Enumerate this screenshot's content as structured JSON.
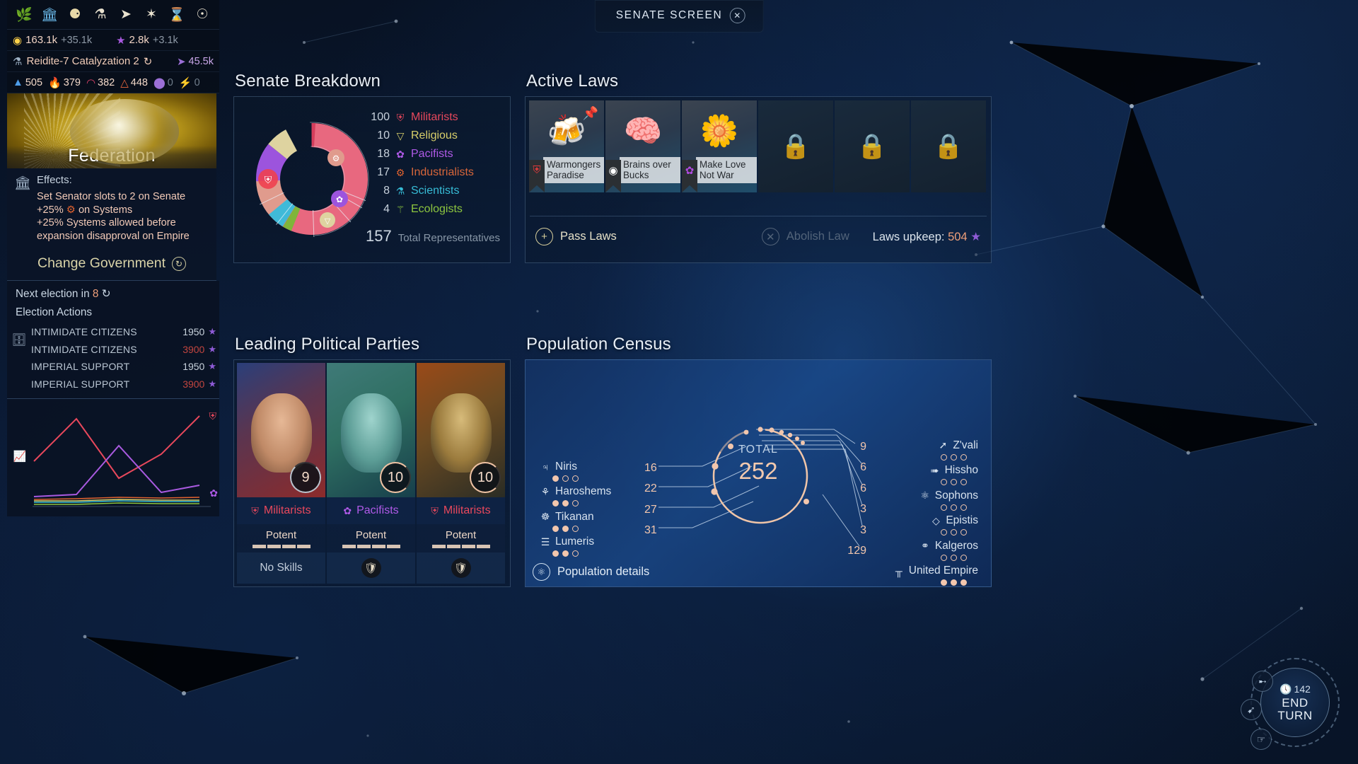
{
  "screen": {
    "title": "SENATE SCREEN",
    "close_icon": "close-icon"
  },
  "hud": {
    "icons": [
      "laurel-icon",
      "senate-building-icon",
      "coins-icon",
      "science-flask-icon",
      "ship-icon",
      "quest-sun-icon",
      "hourglass-icon",
      "eye-icon"
    ],
    "resources": {
      "dust_value": "163.1k",
      "dust_gain": "+35.1k",
      "influence_value": "2.8k",
      "influence_gain": "+3.1k"
    },
    "research": {
      "name": "Reidite-7 Catalyzation 2",
      "turn_icon": "turn-icon",
      "science_value": "45.5k"
    },
    "strategics": [
      {
        "icon": "titanium-icon",
        "value": "505",
        "color": "#4d9ce8"
      },
      {
        "icon": "hyperium-icon",
        "value": "379",
        "color": "#f2c64a"
      },
      {
        "icon": "adamantian-icon",
        "value": "382",
        "color": "#e0436b"
      },
      {
        "icon": "orichalcix-icon",
        "value": "448",
        "color": "#e8663c"
      },
      {
        "icon": "quadrinix-icon",
        "value": "0",
        "color": "#9b6fd6"
      },
      {
        "icon": "antimatter-icon",
        "value": "0",
        "color": "#3fd68a"
      }
    ]
  },
  "federation": {
    "name": "Federation",
    "effects_label": "Effects:",
    "effects": [
      "Set Senator slots to 2 on Senate",
      "+25% ⚙ on Systems",
      "+25% Systems allowed before expansion disapproval on Empire"
    ],
    "change_government": "Change Government",
    "change_government_icon": "refresh-icon"
  },
  "election": {
    "next_election": "Next election in 8",
    "next_election_turns": "8",
    "actions_label": "Election Actions",
    "actions": [
      {
        "name": "INTIMIDATE CITIZENS",
        "cost": "1950",
        "affordable": true
      },
      {
        "name": "INTIMIDATE CITIZENS",
        "cost": "3900",
        "affordable": false
      },
      {
        "name": "IMPERIAL SUPPORT",
        "cost": "1950",
        "affordable": true
      },
      {
        "name": "IMPERIAL SUPPORT",
        "cost": "3900",
        "affordable": false
      }
    ]
  },
  "senate_breakdown": {
    "title": "Senate Breakdown",
    "total_value": "157",
    "total_label": "Total Representatives"
  },
  "active_laws": {
    "title": "Active Laws",
    "cards": [
      {
        "name": "Warmongers Paradise",
        "glyph": "☥",
        "icon": "beer-peace-icon",
        "party_icon": "militarist-icon",
        "party_color": "#e33b3b",
        "pinned": true,
        "locked": false
      },
      {
        "name": "Brains over Bucks",
        "glyph": "⚛",
        "icon": "brain-hand-icon",
        "party_icon": "dust-icon",
        "party_color": "#ffffff",
        "pinned": false,
        "locked": false
      },
      {
        "name": "Make Love Not War",
        "glyph": "✿",
        "icon": "flower-face-icon",
        "party_icon": "pacifist-icon",
        "party_color": "#b04ae0",
        "pinned": false,
        "locked": false
      },
      {
        "name": "",
        "icon": "lock-icon",
        "locked": true
      },
      {
        "name": "",
        "icon": "lock-icon",
        "locked": true
      },
      {
        "name": "",
        "icon": "lock-icon",
        "locked": true
      }
    ],
    "pass_laws": "Pass Laws",
    "abolish_law": "Abolish Law",
    "upkeep_label": "Laws upkeep:",
    "upkeep_value": "504"
  },
  "parties": {
    "title": "Leading Political Parties",
    "items": [
      {
        "name": "Militarists",
        "color": "#e8485c",
        "icon": "militarist-icon",
        "score": "9",
        "potency": "Potent",
        "potency_level": 3,
        "skill": "No Skills",
        "has_skill_badge": false
      },
      {
        "name": "Pacifists",
        "color": "#b05ae8",
        "icon": "pacifist-icon",
        "score": "10",
        "potency": "Potent",
        "potency_level": 3,
        "skill": "",
        "has_skill_badge": true
      },
      {
        "name": "Militarists",
        "color": "#e8485c",
        "icon": "militarist-icon",
        "score": "10",
        "potency": "Potent",
        "potency_level": 3,
        "skill": "",
        "has_skill_badge": true
      }
    ]
  },
  "census": {
    "title": "Population Census",
    "total_label": "TOTAL",
    "total_value": "252",
    "left": [
      {
        "name": "Niris",
        "icon": "niris-icon",
        "value": "16",
        "pips": 1
      },
      {
        "name": "Haroshems",
        "icon": "haroshems-icon",
        "value": "22",
        "pips": 2
      },
      {
        "name": "Tikanan",
        "icon": "tikanan-icon",
        "value": "27",
        "pips": 2
      },
      {
        "name": "Lumeris",
        "icon": "lumeris-icon",
        "value": "31",
        "pips": 2
      }
    ],
    "right": [
      {
        "name": "Z'vali",
        "icon": "zvali-icon",
        "value": "9",
        "pips": 0
      },
      {
        "name": "Hissho",
        "icon": "hissho-icon",
        "value": "6",
        "pips": 0
      },
      {
        "name": "Sophons",
        "icon": "sophons-icon",
        "value": "6",
        "pips": 0
      },
      {
        "name": "Epistis",
        "icon": "epistis-icon",
        "value": "3",
        "pips": 0
      },
      {
        "name": "Kalgeros",
        "icon": "kalgeros-icon",
        "value": "3",
        "pips": 0
      },
      {
        "name": "United Empire",
        "icon": "united-empire-icon",
        "value": "129",
        "pips": 3
      }
    ],
    "details_label": "Population details",
    "details_icon": "population-icon"
  },
  "end_turn": {
    "turn_label": "142",
    "clock_icon": "clock-icon",
    "label_line1": "END",
    "label_line2": "TURN",
    "side_buttons": [
      "help-icon",
      "notify-icon",
      "cursor-icon"
    ]
  },
  "chart_data": [
    {
      "type": "pie",
      "title": "Senate Breakdown",
      "categories": [
        "Militarists",
        "Religious",
        "Pacifists",
        "Industrialists",
        "Scientists",
        "Ecologists"
      ],
      "values": [
        100,
        10,
        18,
        17,
        8,
        4
      ],
      "colors": [
        "#e8485c",
        "#d8cf6a",
        "#b05ae8",
        "#e0622f",
        "#37bcd6",
        "#8dc63f"
      ],
      "total": 157,
      "total_label": "Total Representatives",
      "legend_position": "right"
    },
    {
      "type": "pie",
      "title": "Population Census",
      "categories": [
        "Niris",
        "Haroshems",
        "Tikanan",
        "Lumeris",
        "Z'vali",
        "Hissho",
        "Sophons",
        "Epistis",
        "Kalgeros",
        "United Empire"
      ],
      "values": [
        16,
        22,
        27,
        31,
        9,
        6,
        6,
        3,
        3,
        129
      ],
      "total": 252,
      "total_label": "TOTAL",
      "legend_position": "split-left-right"
    },
    {
      "type": "line",
      "title": "Party trends",
      "series": [
        {
          "name": "Militarists",
          "color": "#e8485c",
          "values": [
            44,
            72,
            30,
            52,
            78
          ]
        },
        {
          "name": "Pacifists",
          "color": "#a95ae0",
          "values": [
            10,
            12,
            40,
            14,
            20
          ]
        },
        {
          "name": "Industrialists",
          "color": "#e0622f",
          "values": [
            8,
            9,
            10,
            9,
            9
          ]
        },
        {
          "name": "Scientists",
          "color": "#37bcd6",
          "values": [
            6,
            6,
            7,
            6,
            6
          ]
        },
        {
          "name": "Ecologists",
          "color": "#8dc63f",
          "values": [
            4,
            4,
            5,
            4,
            4
          ]
        },
        {
          "name": "Religious",
          "color": "#d8cf6a",
          "values": [
            5,
            5,
            5,
            5,
            5
          ]
        }
      ],
      "grid": false
    }
  ]
}
